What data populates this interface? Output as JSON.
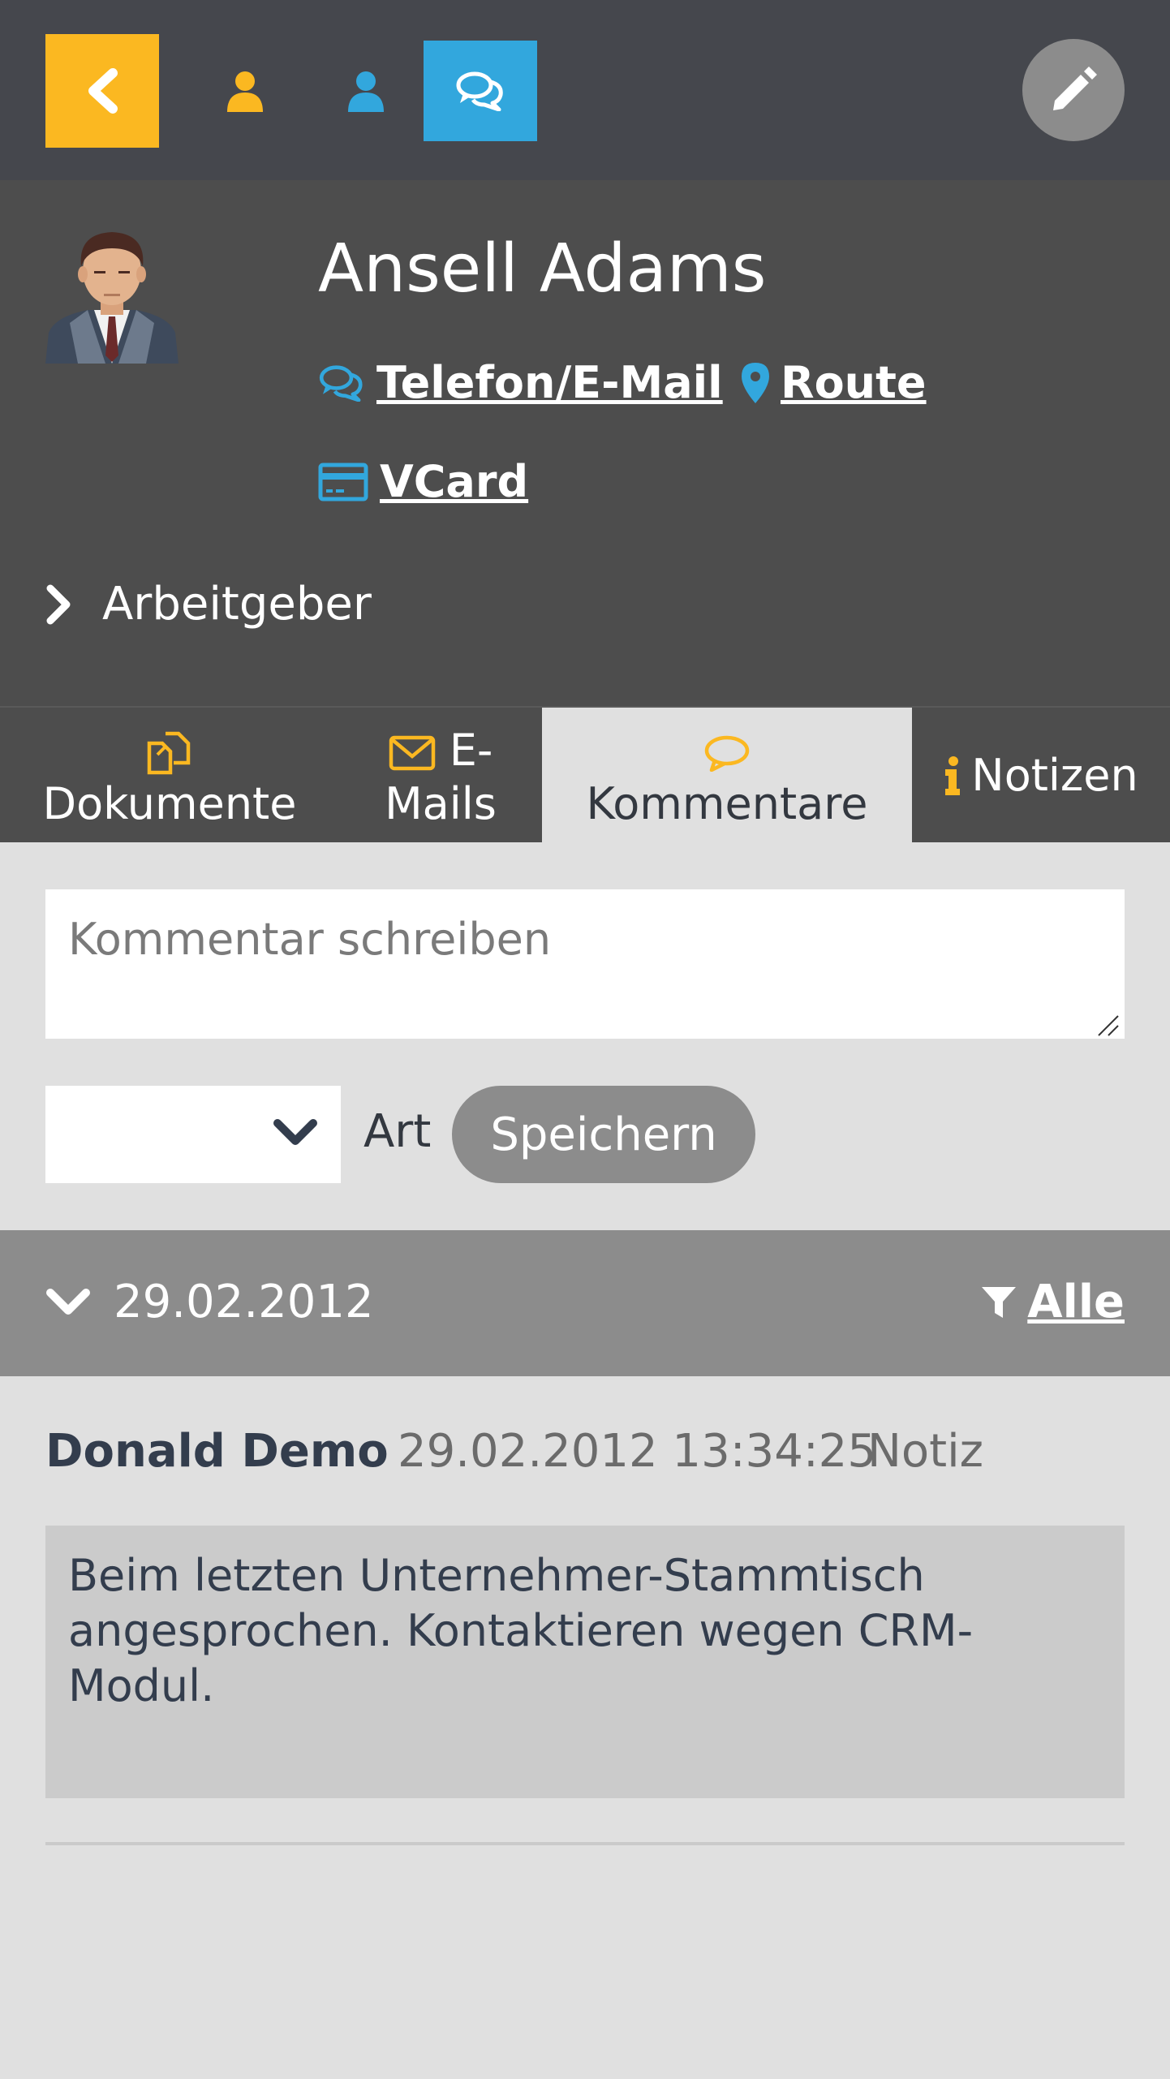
{
  "topbar": {
    "back_icon": "chevron-left-icon",
    "user_icon_1": "user-icon",
    "user_icon_2": "user-icon",
    "chat_icon": "comments-icon",
    "edit_icon": "pencil-icon",
    "colors": {
      "bar": "#45474d",
      "accent_yellow": "#fbb821",
      "accent_blue": "#32a7dd",
      "edit": "#8c8c8c"
    }
  },
  "profile": {
    "name": "Ansell Adams",
    "links": {
      "phone_email": "Telefon/E-Mail",
      "route": "Route",
      "vcard": "VCard"
    },
    "employer_label": "Arbeitgeber"
  },
  "tabs": {
    "documents": "Dokumente",
    "emails_line1": "E-",
    "emails_line2": "Mails",
    "comments": "Kommentare",
    "notes": "Notizen"
  },
  "comment_form": {
    "placeholder": "Kommentar schreiben",
    "type_select_value": "",
    "type_label": "Art",
    "save_label": "Speichern"
  },
  "date_group": {
    "date": "29.02.2012",
    "filter_label": "Alle"
  },
  "entry": {
    "author": "Donald Demo",
    "timestamp": "29.02.2012 13:34:25",
    "kind": "Notiz",
    "text": "Beim letzten Unternehmer-Stammtisch angesprochen. Kontaktieren wegen CRM-Modul."
  }
}
